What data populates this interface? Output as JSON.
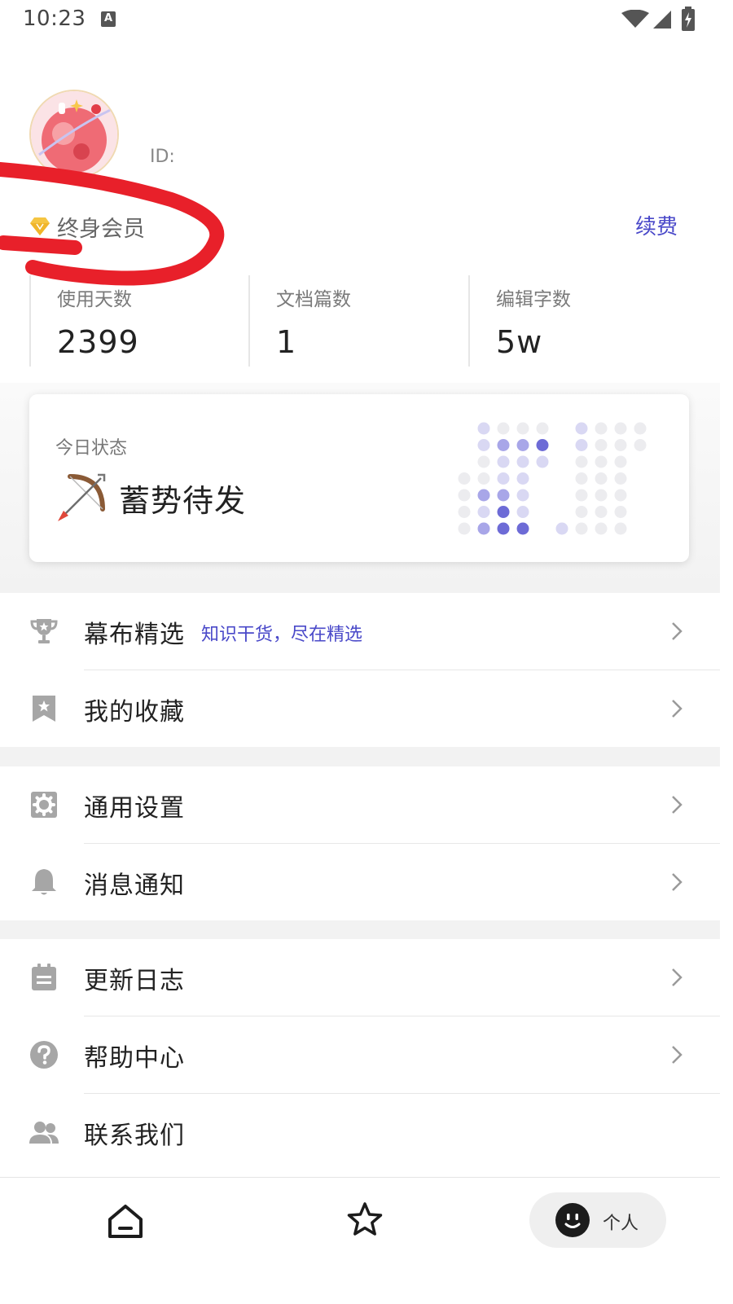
{
  "status_bar": {
    "time": "10:23",
    "notification_icon": "A"
  },
  "profile": {
    "id_label": "ID:",
    "membership": "终身会员",
    "renew_label": "续费"
  },
  "stats": [
    {
      "label": "使用天数",
      "value": "2399"
    },
    {
      "label": "文档篇数",
      "value": "1"
    },
    {
      "label": "编辑字数",
      "value": "5w"
    }
  ],
  "today": {
    "title": "今日状态",
    "status": "蓄势待发"
  },
  "menu": {
    "featured": {
      "label": "幕布精选",
      "subtitle": "知识干货，尽在精选"
    },
    "favorites": {
      "label": "我的收藏"
    },
    "settings": {
      "label": "通用设置"
    },
    "notifications": {
      "label": "消息通知"
    },
    "changelog": {
      "label": "更新日志"
    },
    "help": {
      "label": "帮助中心"
    },
    "contact": {
      "label": "联系我们"
    }
  },
  "bottom_nav": {
    "me_label": "个人"
  },
  "colors": {
    "accent": "#4a49c9",
    "annotation": "#e8202a"
  }
}
